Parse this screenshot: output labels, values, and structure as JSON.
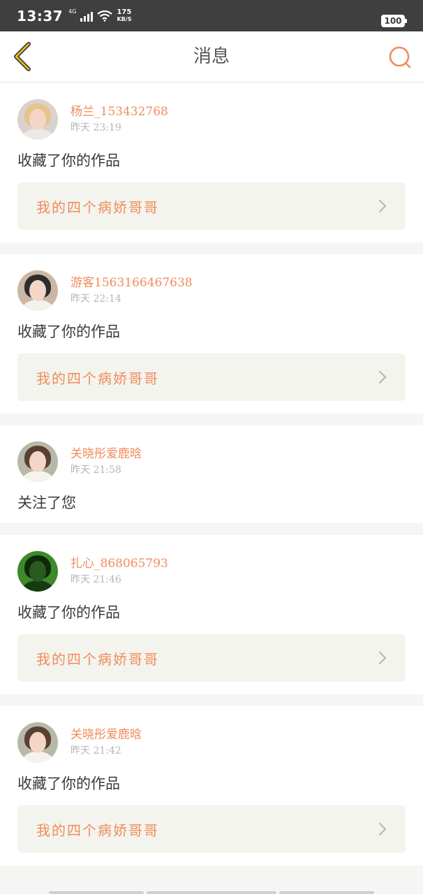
{
  "status_bar": {
    "time": "13:37",
    "network": "4G",
    "speed_value": "175",
    "speed_unit": "KB/S",
    "battery": "100"
  },
  "header": {
    "title": "消息",
    "back_icon": "chevron-left-icon",
    "search_icon": "search-icon",
    "accent_color": "#ef8c5c"
  },
  "messages": [
    {
      "user": "杨兰_153432768",
      "time": "昨天 23:19",
      "action": "收藏了你的作品",
      "work_title": "我的四个病娇哥哥"
    },
    {
      "user": "游客1563166467638",
      "time": "昨天 22:14",
      "action": "收藏了你的作品",
      "work_title": "我的四个病娇哥哥"
    },
    {
      "user": "关晓彤爱鹿晗",
      "time": "昨天 21:58",
      "action": "关注了您"
    },
    {
      "user": "扎心_868065793",
      "time": "昨天 21:46",
      "action": "收藏了你的作品",
      "work_title": "我的四个病娇哥哥"
    },
    {
      "user": "关晓彤爱鹿晗",
      "time": "昨天 21:42",
      "action": "收藏了你的作品",
      "work_title": "我的四个病娇哥哥"
    }
  ]
}
